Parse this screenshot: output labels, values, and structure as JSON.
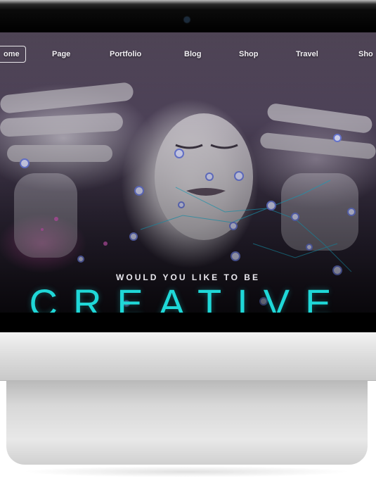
{
  "nav": {
    "items": [
      {
        "label": "ome",
        "active": true
      },
      {
        "label": "Page",
        "active": false
      },
      {
        "label": "Portfolio",
        "active": false
      },
      {
        "label": "Blog",
        "active": false
      },
      {
        "label": "Shop",
        "active": false
      },
      {
        "label": "Travel",
        "active": false
      },
      {
        "label": "Sho",
        "active": false
      }
    ]
  },
  "hero": {
    "tagline": "WOULD YOU LIKE TO BE",
    "headline": "CREATIVE"
  },
  "colors": {
    "accent": "#1fd8d8",
    "node": "#d6d8f5",
    "nav_text": "#f2f0f4"
  }
}
